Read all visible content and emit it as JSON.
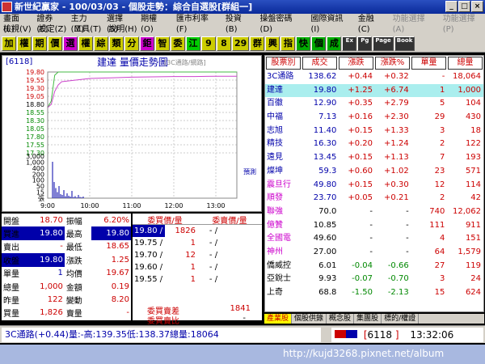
{
  "window": {
    "title": "新世紀贏家 - 100/03/03 - 個股走勢：綜合自選股[群組一]"
  },
  "menu": {
    "row1": [
      "畫面(L)",
      "證券(E)",
      "主力(M)",
      "選擇(S)",
      "期權(O)",
      "匯市利率(F)",
      "投資(B)",
      "操盤密碼(D)",
      "國際資訊(I)",
      "金融(C)",
      "功能選擇(A)",
      "功能選擇(P)"
    ],
    "row2": [
      "檢視(V)",
      "設定(Z)",
      "工具(T)",
      "說明(H)"
    ]
  },
  "toolbar": [
    "加",
    "權",
    "期",
    "價",
    "選",
    "權",
    "綜",
    "類",
    "分",
    "鉅",
    "智",
    "委",
    "江",
    "9",
    "8",
    "29",
    "群",
    "興",
    "指",
    "快",
    "個",
    "成"
  ],
  "chart": {
    "code": "[6118]",
    "title": "建達  量價走勢圖",
    "subtitle": "[3C通路/網路]",
    "y_labels": [
      "19.80",
      "19.55",
      "19.30",
      "19.05",
      "18.80",
      "18.55",
      "18.30",
      "18.05",
      "17.80",
      "17.55",
      "17.30"
    ],
    "vol_labels": [
      "3,000",
      "1,000",
      "400",
      "200",
      "100",
      "50",
      "15",
      "張"
    ],
    "x_labels": [
      "9:00",
      "10:00",
      "11:00",
      "12:00",
      "13:00"
    ],
    "tag": "預測"
  },
  "chart_data": {
    "type": "line",
    "title": "建達  量價走勢圖",
    "series": [
      {
        "name": "",
        "x": [
          "9:00",
          "9:05",
          "9:10",
          "9:15",
          "9:20",
          "9:40",
          "10:00",
          "10:30",
          "11:00",
          "11:30",
          "12:00",
          "12:30",
          "13:00",
          "13:30"
        ],
        "values": [
          18.7,
          18.9,
          19.7,
          19.8,
          19.8,
          19.8,
          19.8,
          19.8,
          19.8,
          19.8,
          19.8,
          19.8,
          19.8,
          19.8
        ]
      },
      {
        "name": "",
        "x": [
          "9:00",
          "9:05",
          "9:10",
          "9:15",
          "9:20",
          "9:40",
          "10:00",
          "10:30",
          "11:00",
          "11:30",
          "12:00",
          "12:30",
          "13:00",
          "13:30"
        ],
        "values": [
          18.7,
          18.8,
          19.2,
          19.4,
          19.5,
          19.55,
          19.6,
          19.62,
          19.64,
          19.65,
          19.66,
          19.66,
          19.67,
          19.67
        ]
      }
    ],
    "ylim": [
      17.3,
      19.8
    ]
  },
  "stats": [
    [
      "開盤",
      "18.70",
      "振幅",
      "6.20%"
    ],
    [
      "買進",
      "19.80",
      "最高",
      "19.80"
    ],
    [
      "賣出",
      "-",
      "最低",
      "18.65"
    ],
    [
      "收盤",
      "19.80",
      "漲跌",
      "1.25"
    ],
    [
      "單量",
      "1",
      "均價",
      "19.67"
    ],
    [
      "總量",
      "1,000",
      "金額",
      "0.19"
    ],
    [
      "昨量",
      "122",
      "變動",
      "8.20"
    ],
    [
      "買量",
      "1,826",
      "賣量",
      "-"
    ]
  ],
  "book": {
    "headers": [
      "委買價/量",
      "委賣價/量"
    ],
    "rows": [
      [
        "19.80",
        "1826",
        "-",
        ""
      ],
      [
        "19.75",
        "1",
        "-",
        ""
      ],
      [
        "19.70",
        "12",
        "-",
        ""
      ],
      [
        "19.60",
        "1",
        "-",
        ""
      ],
      [
        "19.55",
        "1",
        "-",
        ""
      ]
    ],
    "diff_label": "委買賣差",
    "diff_value": "1841",
    "ratio_label": "委買賣比",
    "ratio_value": "-"
  },
  "quotes": {
    "headers": [
      "股票別",
      "成交",
      "漲跌",
      "漲跌%",
      "單量",
      "總量"
    ],
    "rows": [
      [
        "3C通路",
        "138.62",
        "+0.44",
        "+0.32",
        "-",
        "18,064"
      ],
      [
        "建達",
        "19.80",
        "+1.25",
        "+6.74",
        "1",
        "1,000"
      ],
      [
        "百徽",
        "12.90",
        "+0.35",
        "+2.79",
        "5",
        "104"
      ],
      [
        "中福",
        "7.13",
        "+0.16",
        "+2.30",
        "29",
        "430"
      ],
      [
        "志旭",
        "11.40",
        "+0.15",
        "+1.33",
        "3",
        "18"
      ],
      [
        "精技",
        "16.30",
        "+0.20",
        "+1.24",
        "2",
        "122"
      ],
      [
        "遠見",
        "13.45",
        "+0.15",
        "+1.13",
        "7",
        "193"
      ],
      [
        "燦坤",
        "59.3",
        "+0.60",
        "+1.02",
        "23",
        "571"
      ],
      [
        "震旦行",
        "49.80",
        "+0.15",
        "+0.30",
        "12",
        "114"
      ],
      [
        "順發",
        "23.70",
        "+0.05",
        "+0.21",
        "2",
        "42"
      ],
      [
        "聯強",
        "70.0",
        "-",
        "-",
        "740",
        "12,062"
      ],
      [
        "億贊",
        "10.85",
        "-",
        "-",
        "111",
        "911"
      ],
      [
        "全國電",
        "49.60",
        "-",
        "-",
        "4",
        "151"
      ],
      [
        "神州",
        "27.00",
        "-",
        "-",
        "64",
        "1,579"
      ],
      [
        "僑威控",
        "6.01",
        "-0.04",
        "-0.66",
        "27",
        "119"
      ],
      [
        "亞銳士",
        "9.93",
        "-0.07",
        "-0.70",
        "3",
        "24"
      ],
      [
        "上奇",
        "68.8",
        "-1.50",
        "-2.13",
        "15",
        "624"
      ]
    ]
  },
  "tabs": [
    "產業股",
    "個股供錄",
    "概念股",
    "集團股",
    "標的/權證"
  ],
  "status": {
    "left": "3C通路(+0.44)量:-高:139.35低:138.37總量:18064",
    "code": "6118",
    "time": "13:32:06"
  },
  "taskbar": {
    "watermark": "http://kujd3268.pixnet.net/album"
  },
  "colors": {
    "up": "#cc0000",
    "down": "#008800",
    "title_blue": "#0a2a9a",
    "highlight": "#0000aa"
  }
}
